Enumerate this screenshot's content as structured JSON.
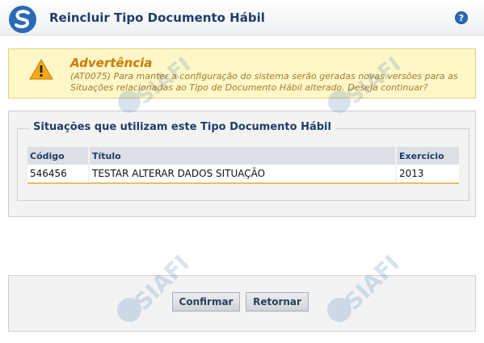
{
  "header": {
    "title": "Reincluir Tipo Documento Hábil",
    "help_label": "?",
    "logo_icon": "siafi-logo-icon",
    "help_icon": "help-icon"
  },
  "warning": {
    "title": "Advertência",
    "message": "(AT0075) Para manter a configuração do sistema serão geradas novas versões para as Situações relacionadas ao Tipo de Documento Hábil alterado. Deseja continuar?",
    "icon": "warning-triangle-icon"
  },
  "situations": {
    "legend": "Situações que utilizam este Tipo Documento Hábil",
    "columns": [
      "Código",
      "Título",
      "Exercício"
    ],
    "rows": [
      [
        "546456",
        "TESTAR ALTERAR DADOS SITUAÇÃO",
        "2013"
      ]
    ]
  },
  "actions": {
    "confirm_label": "Confirmar",
    "back_label": "Retornar"
  },
  "watermark_text": "SIAFI",
  "colors": {
    "title_blue": "#1f3d6b",
    "warning_bg": "#fff7c8",
    "warning_title": "#cc7a00",
    "row_underline": "#e6c15a"
  }
}
